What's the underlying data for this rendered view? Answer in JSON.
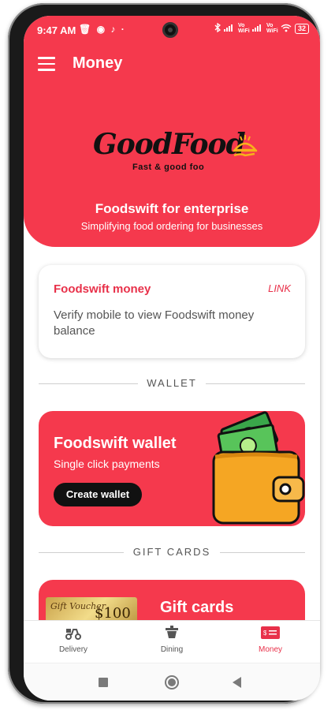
{
  "status": {
    "time": "9:47 AM",
    "left_icons": "🗑 ◉ ♪ ·",
    "signal_1": "Vo WiFi",
    "signal_2": "Vo WiFi",
    "battery": "32"
  },
  "topbar": {
    "title": "Money",
    "menu_icon": "hamburger-icon"
  },
  "hero": {
    "logo_text": "GoodFood",
    "logo_tagline": "Fast & good foo",
    "title": "Foodswift for enterprise",
    "subtitle": "Simplifying food ordering for businesses"
  },
  "money_card": {
    "title": "Foodswift money",
    "link": "LINK",
    "description": "Verify mobile to view Foodswift money balance"
  },
  "sections": {
    "wallet": "WALLET",
    "gift_cards": "GIFT CARDS"
  },
  "wallet_card": {
    "title": "Foodswift wallet",
    "subtitle": "Single click payments",
    "button": "Create wallet"
  },
  "gift_card": {
    "voucher_text": "Gift Voucher",
    "voucher_amount": "$100",
    "title": "Gift cards"
  },
  "bottom_nav": [
    {
      "label": "Delivery",
      "icon": "scooter-icon",
      "active": false
    },
    {
      "label": "Dining",
      "icon": "dining-icon",
      "active": false
    },
    {
      "label": "Money",
      "icon": "money-icon",
      "active": true
    }
  ],
  "colors": {
    "brand": "#f5394d",
    "accent_text": "#e8314a"
  }
}
